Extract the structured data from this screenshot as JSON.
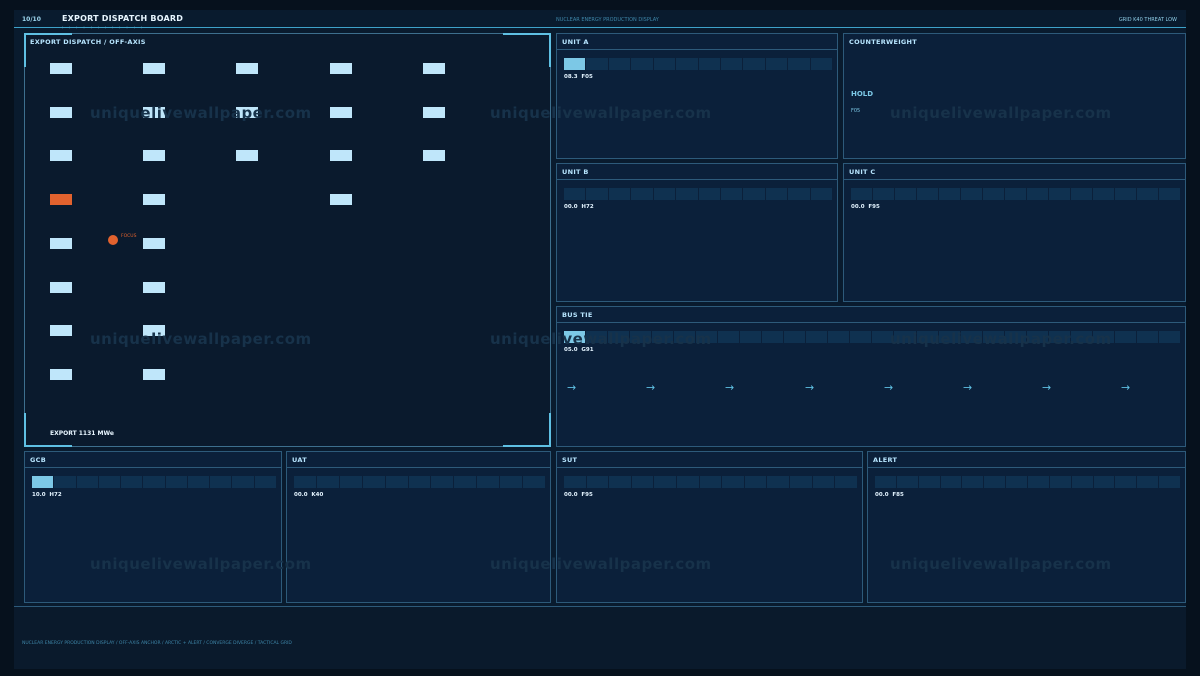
{
  "topbar": {
    "page": "10/10",
    "title": "EXPORT DISPATCH BOARD",
    "ticks": "| | | | | | | | | | | |",
    "center": "NUCLEAR ENERGY PRODUCTION DISPLAY",
    "right": "GRID K40  THREAT LOW"
  },
  "main": {
    "title": "EXPORT DISPATCH  /  OFF-AXIS",
    "focus_label": "FOCUS",
    "export_label": "EXPORT 1131 MWe",
    "columns": [
      {
        "cells": [
          "on",
          "on",
          "on",
          "alert",
          "on",
          "on",
          "on",
          "on"
        ]
      },
      {
        "cells": [
          "on",
          "on",
          "on",
          "on",
          "on",
          "on",
          "on",
          "on"
        ]
      },
      {
        "cells": [
          "on",
          "on",
          "on"
        ]
      },
      {
        "cells": [
          "on",
          "on",
          "on",
          "on"
        ]
      },
      {
        "cells": [
          "on",
          "on",
          "on"
        ]
      }
    ]
  },
  "panels": {
    "unit_a": {
      "title": "UNIT A",
      "readout": "08.3  F05",
      "level": 0.08
    },
    "counterweight": {
      "title": "COUNTERWEIGHT",
      "status": "HOLD",
      "sub": "F05"
    },
    "unit_b": {
      "title": "UNIT B",
      "readout": "00.0  H72",
      "level": 0.0
    },
    "unit_c": {
      "title": "UNIT C",
      "readout": "00.0  F95",
      "level": 0.0
    },
    "bus_tie": {
      "title": "BUS TIE",
      "readout": "05.0  G91",
      "level": 0.05,
      "arrow": "→",
      "arrow_count": 8
    },
    "gcb": {
      "title": "GCB",
      "readout": "10.0  H72",
      "level": 0.1
    },
    "uat": {
      "title": "UAT",
      "readout": "00.0  K40",
      "level": 0.0
    },
    "sut": {
      "title": "SUT",
      "readout": "00.0  F95",
      "level": 0.0
    },
    "alert": {
      "title": "ALERT",
      "readout": "00.0  F85",
      "level": 0.0
    }
  },
  "watermark": "uniquelivewallpaper.com",
  "footer": "NUCLEAR ENERGY PRODUCTION DISPLAY  /  OFF-AXIS ANCHOR  /  ARCTIC + ALERT  /  CONVERGE DIVERGE  /  TACTICAL GRID",
  "colors": {
    "accent": "#5fc0e3",
    "fill": "#bfe6fa",
    "alert": "#e2622e",
    "bg": "#091b2e"
  }
}
